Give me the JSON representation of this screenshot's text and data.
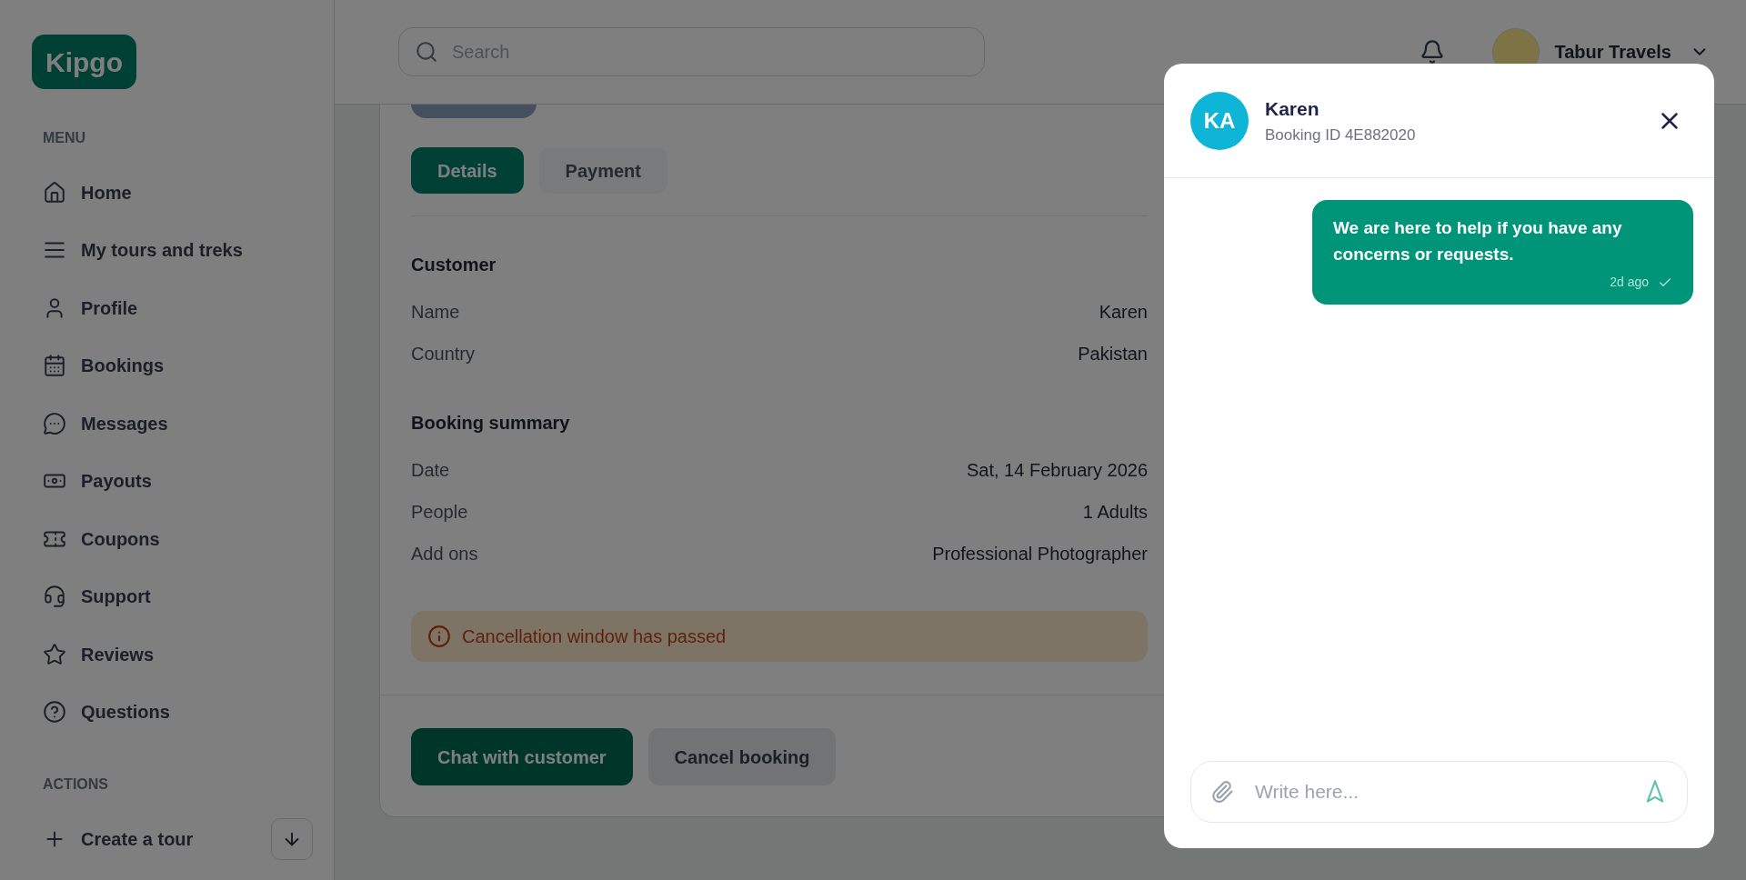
{
  "sidebar": {
    "logo": "Kipgo",
    "sections": [
      {
        "title": "MENU",
        "items": [
          {
            "label": "Home"
          },
          {
            "label": "My tours and treks"
          },
          {
            "label": "Profile"
          },
          {
            "label": "Bookings"
          },
          {
            "label": "Messages"
          },
          {
            "label": "Payouts"
          },
          {
            "label": "Coupons"
          },
          {
            "label": "Support"
          },
          {
            "label": "Reviews"
          },
          {
            "label": "Questions"
          }
        ]
      },
      {
        "title": "ACTIONS",
        "items": [
          {
            "label": "Create a tour"
          }
        ]
      }
    ]
  },
  "header": {
    "search": {
      "placeholder": "Search"
    },
    "account": {
      "name": "Tabur Travels"
    }
  },
  "booking": {
    "tabs": [
      {
        "label": "Details",
        "selected": true
      },
      {
        "label": "Payment",
        "selected": false
      }
    ],
    "sections": [
      {
        "title": "Customer",
        "rows": [
          {
            "label": "Name",
            "value": "Karen"
          },
          {
            "label": "Country",
            "value": "Pakistan"
          }
        ]
      },
      {
        "title": "Booking summary",
        "rows": [
          {
            "label": "Date",
            "value": "Sat, 14 February 2026"
          },
          {
            "label": "People",
            "value": "1 Adults"
          },
          {
            "label": "Add ons",
            "value": "Professional Photographer"
          }
        ]
      }
    ],
    "alert": "Cancellation window has passed",
    "buttons": [
      {
        "label": "Chat with customer",
        "kind": "primary"
      },
      {
        "label": "Cancel booking",
        "kind": "secondary"
      }
    ]
  },
  "chat": {
    "initials": "KA",
    "name": "Karen",
    "subtitle": "Booking ID 4E882020",
    "messages": [
      {
        "text": "We are here to help if you have any concerns or requests.",
        "time": "2d ago"
      }
    ],
    "input": {
      "placeholder": "Write here..."
    }
  }
}
